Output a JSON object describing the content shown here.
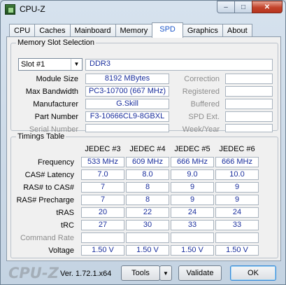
{
  "window": {
    "title": "CPU-Z"
  },
  "caption": {
    "minimize": "–",
    "maximize": "□",
    "close": "✕"
  },
  "tabs": [
    "CPU",
    "Caches",
    "Mainboard",
    "Memory",
    "SPD",
    "Graphics",
    "About"
  ],
  "active_tab": "SPD",
  "memory_slot_selection": {
    "title": "Memory Slot Selection",
    "slot_value": "Slot #1",
    "memory_type": "DDR3",
    "module_size_label": "Module Size",
    "module_size": "8192 MBytes",
    "max_bandwidth_label": "Max Bandwidth",
    "max_bandwidth": "PC3-10700 (667 MHz)",
    "manufacturer_label": "Manufacturer",
    "manufacturer": "G.Skill",
    "part_number_label": "Part Number",
    "part_number": "F3-10666CL9-8GBXL",
    "serial_number_label": "Serial Number",
    "serial_number": "",
    "correction_label": "Correction",
    "correction": "",
    "registered_label": "Registered",
    "registered": "",
    "buffered_label": "Buffered",
    "buffered": "",
    "spd_ext_label": "SPD Ext.",
    "spd_ext": "",
    "week_year_label": "Week/Year",
    "week_year": ""
  },
  "timings_table": {
    "title": "Timings Table",
    "columns": [
      "JEDEC #3",
      "JEDEC #4",
      "JEDEC #5",
      "JEDEC #6"
    ],
    "rows": [
      {
        "label": "Frequency",
        "values": [
          "533 MHz",
          "609 MHz",
          "666 MHz",
          "666 MHz"
        ]
      },
      {
        "label": "CAS# Latency",
        "values": [
          "7.0",
          "8.0",
          "9.0",
          "10.0"
        ]
      },
      {
        "label": "RAS# to CAS#",
        "values": [
          "7",
          "8",
          "9",
          "9"
        ]
      },
      {
        "label": "RAS# Precharge",
        "values": [
          "7",
          "8",
          "9",
          "9"
        ]
      },
      {
        "label": "tRAS",
        "values": [
          "20",
          "22",
          "24",
          "24"
        ]
      },
      {
        "label": "tRC",
        "values": [
          "27",
          "30",
          "33",
          "33"
        ]
      },
      {
        "label": "Command Rate",
        "values": [
          "",
          "",
          "",
          ""
        ]
      },
      {
        "label": "Voltage",
        "values": [
          "1.50 V",
          "1.50 V",
          "1.50 V",
          "1.50 V"
        ]
      }
    ]
  },
  "footer": {
    "logo": "CPU-Z",
    "version": "Ver. 1.72.1.x64",
    "tools_label": "Tools",
    "validate_label": "Validate",
    "ok_label": "OK"
  }
}
